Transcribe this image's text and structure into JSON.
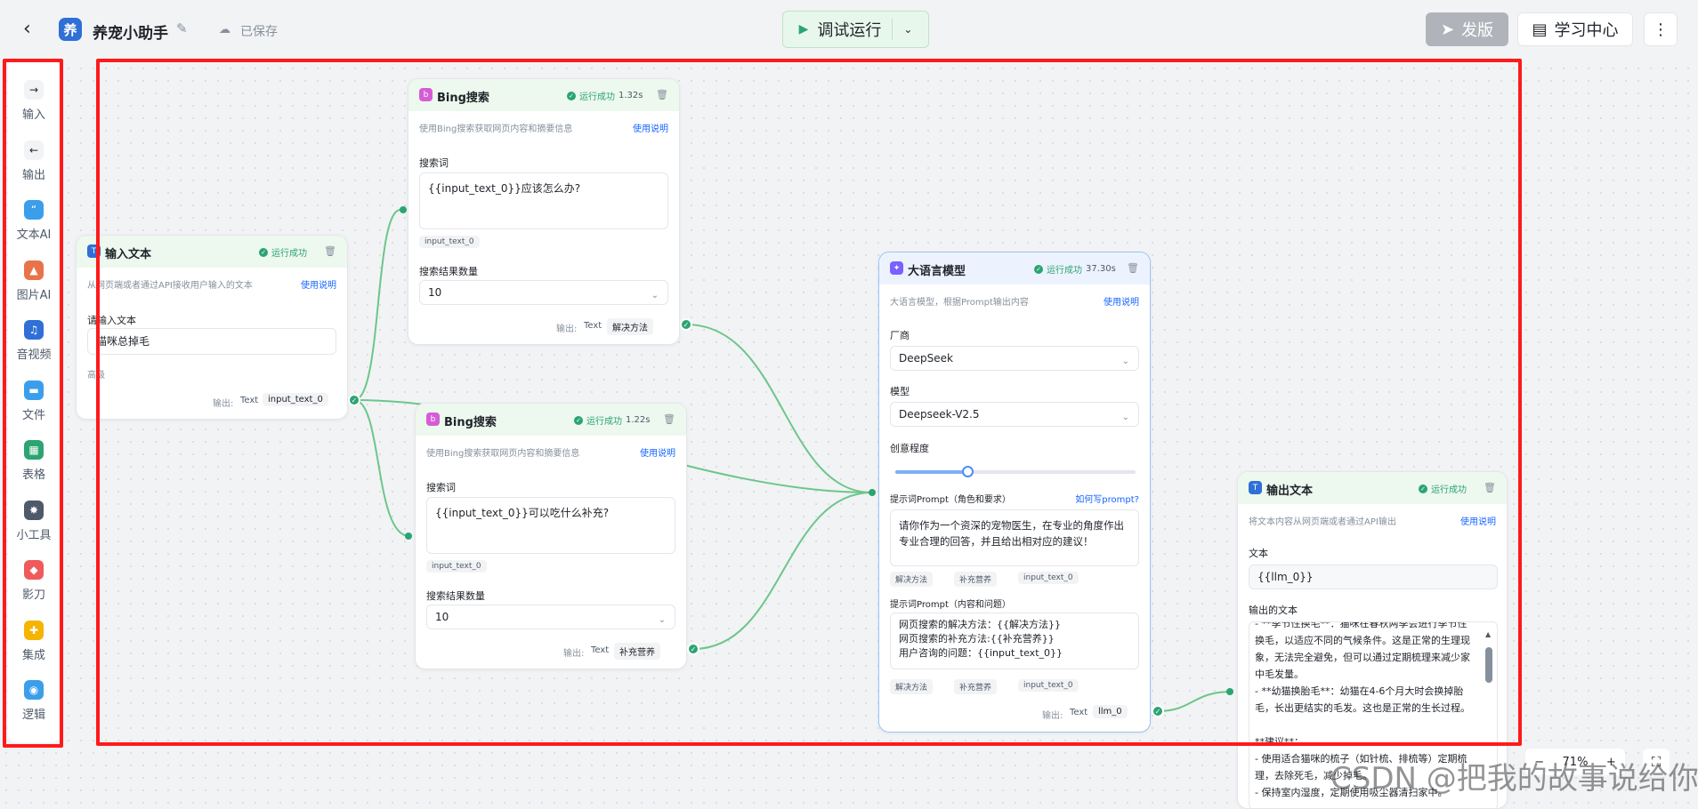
{
  "app": {
    "logo_char": "养",
    "title": "养宠小助手",
    "saved": "已保存"
  },
  "toolbar": {
    "run": "调试运行",
    "publish": "发版",
    "learn": "学习中心"
  },
  "sidebar": [
    {
      "label": "输入",
      "icon": "arrow-right-icon",
      "color": "#86909c"
    },
    {
      "label": "输出",
      "icon": "arrow-left-icon",
      "color": "#86909c"
    },
    {
      "label": "文本AI",
      "icon": "quote-icon",
      "color": "#3b9eea"
    },
    {
      "label": "图片AI",
      "icon": "image-icon",
      "color": "#e8734a"
    },
    {
      "label": "音视频",
      "icon": "media-icon",
      "color": "#2f6fd6"
    },
    {
      "label": "文件",
      "icon": "folder-icon",
      "color": "#3b9eea"
    },
    {
      "label": "表格",
      "icon": "table-icon",
      "color": "#2ba471"
    },
    {
      "label": "小工具",
      "icon": "gear-icon",
      "color": "#4e5969"
    },
    {
      "label": "影刀",
      "icon": "blade-icon",
      "color": "#f05a5a"
    },
    {
      "label": "集成",
      "icon": "puzzle-icon",
      "color": "#f5b400"
    },
    {
      "label": "逻辑",
      "icon": "logic-icon",
      "color": "#3b9eea"
    }
  ],
  "nodes": {
    "input": {
      "title": "输入文本",
      "status": "运行成功",
      "desc": "从网页端或者通过API接收用户输入的文本",
      "help": "使用说明",
      "field_label": "请输入文本",
      "value": "猫咪总掉毛",
      "advanced": "高级",
      "out_label": "输出:",
      "out_type": "Text",
      "out_var": "input_text_0"
    },
    "bing1": {
      "title": "Bing搜索",
      "status": "运行成功",
      "time": "1.32s",
      "desc": "使用Bing搜索获取网页内容和摘要信息",
      "help": "使用说明",
      "q_label": "搜索词",
      "query": "{{input_text_0}}应该怎么办?",
      "tag": "input_text_0",
      "count_label": "搜索结果数量",
      "count": "10",
      "out_label": "输出:",
      "out_type": "Text",
      "out_var": "解决方法"
    },
    "bing2": {
      "title": "Bing搜索",
      "status": "运行成功",
      "time": "1.22s",
      "desc": "使用Bing搜索获取网页内容和摘要信息",
      "help": "使用说明",
      "q_label": "搜索词",
      "query": "{{input_text_0}}可以吃什么补充?",
      "tag": "input_text_0",
      "count_label": "搜索结果数量",
      "count": "10",
      "out_label": "输出:",
      "out_type": "Text",
      "out_var": "补充营养"
    },
    "llm": {
      "title": "大语言模型",
      "status": "运行成功",
      "time": "37.30s",
      "desc": "大语言模型，根据Prompt输出内容",
      "help": "使用说明",
      "vendor_label": "厂商",
      "vendor": "DeepSeek",
      "model_label": "模型",
      "model": "Deepseek-V2.5",
      "creativity_label": "创意程度",
      "creativity": 0.3,
      "sys_label": "提示词Prompt（角色和要求）",
      "sys_help": "如何写prompt?",
      "sys_prompt": "请你作为一个资深的宠物医生，在专业的角度作出专业合理的回答，并且给出相对应的建议！",
      "tags": [
        "解决方法",
        "补充营养",
        "input_text_0"
      ],
      "user_label": "提示词Prompt（内容和问题）",
      "user_prompt": [
        "网页搜索的解决方法：{{解决方法}}",
        "网页搜索的补充方法:{{补充营养}}",
        "用户咨询的问题：{{input_text_0}}"
      ],
      "out_label": "输出:",
      "out_type": "Text",
      "out_var": "llm_0"
    },
    "output": {
      "title": "输出文本",
      "status": "运行成功",
      "desc": "将文本内容从网页端或者通过API输出",
      "help": "使用说明",
      "text_label": "文本",
      "text": "{{llm_0}}",
      "result_label": "输出的文本",
      "result": [
        "- **季节性换毛**：猫咪在春秋两季会进行季节性换毛，以适应不同的气候条件。这是正常的生理现象，无法完全避免，但可以通过定期梳理来减少家中毛发量。",
        "- **幼猫换胎毛**：幼猫在4-6个月大时会换掉胎毛，长出更结实的毛发。这也是正常的生长过程。",
        "",
        "**建议**：",
        "- 使用适合猫咪的梳子（如针梳、排梳等）定期梳理，去除死毛，减少掉毛。",
        "- 保持室内湿度，定期使用吸尘器清扫家中。"
      ]
    }
  },
  "zoom": {
    "value": "71%"
  },
  "watermark": "CSDN @把我的故事说给你"
}
